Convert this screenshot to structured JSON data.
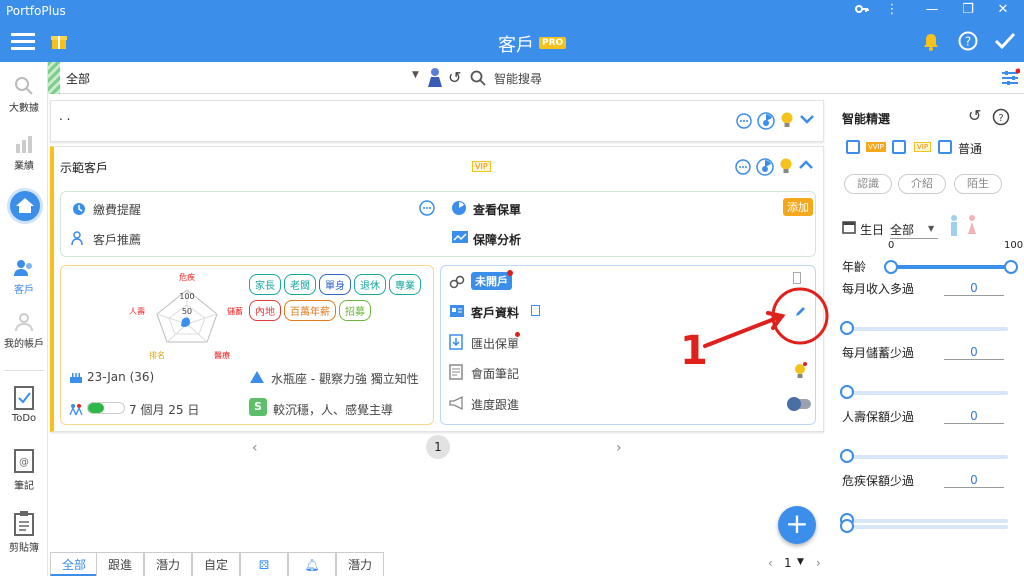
{
  "window": {
    "title": "PortfoPlus"
  },
  "appbar": {
    "title": "客戶",
    "badge": "PRO"
  },
  "nav": {
    "bigdata": "大數據",
    "performance": "業績",
    "clients": "客戶",
    "account": "我的帳戶",
    "todo": "ToDo",
    "notes": "筆記",
    "clipboard": "剪貼簿"
  },
  "filter": {
    "scope": "全部",
    "search_placeholder": "智能搜尋"
  },
  "client1": {
    "name": ". ."
  },
  "client2": {
    "name": "示範客戶",
    "vip": "VIP",
    "payment_reminder": "繳費提醒",
    "view_policy": "查看保單",
    "add_label": "添加",
    "referral": "客戶推薦",
    "coverage": "保障分析",
    "radar": {
      "top": "危疾",
      "left": "人壽",
      "right": "儲蓄",
      "bottom_left": "排名",
      "bottom_right": "醫療",
      "tick100": "100",
      "tick50": "50"
    },
    "tags": [
      {
        "label": "家長",
        "color": "#18a8a0"
      },
      {
        "label": "老闆",
        "color": "#18a8a0"
      },
      {
        "label": "單身",
        "color": "#2d66c8"
      },
      {
        "label": "退休",
        "color": "#18a8a0"
      },
      {
        "label": "專業",
        "color": "#18a8a0"
      },
      {
        "label": "內地",
        "color": "#e23a3a"
      },
      {
        "label": "百萬年薪",
        "color": "#e07a1b"
      },
      {
        "label": "招募",
        "color": "#6db53a"
      }
    ],
    "birthday": "23-Jan (36)",
    "zodiac": "水瓶座 - 觀察力強 獨立知性",
    "progress_text": "7 個月 25 日",
    "progress_pct": 0.45,
    "personality_badge": "S",
    "personality": "較沉穩，人、感覺主導",
    "status": "未開戶",
    "client_info": "客戶資料",
    "export_policy": "匯出保單",
    "meeting_notes": "會面筆記",
    "follow_up": "進度跟進"
  },
  "pagination": {
    "page": "1"
  },
  "annotation": {
    "number": "1"
  },
  "right_panel": {
    "title": "智能精選",
    "vvip": "VVIP",
    "vip": "VIP",
    "normal": "普通",
    "buttons": [
      "認識",
      "介紹",
      "陌生"
    ],
    "birthday_label": "生日",
    "birthday_value": "全部",
    "age_min": "0",
    "age_max": "100",
    "age_label": "年齡",
    "filters": [
      {
        "label": "每月收入多過",
        "value": "0"
      },
      {
        "label": "每月儲蓄少過",
        "value": "0"
      },
      {
        "label": "人壽保額少過",
        "value": "0"
      },
      {
        "label": "危疾保額少過",
        "value": "0"
      }
    ]
  },
  "bottom_tabs": [
    "全部",
    "跟進",
    "潛力",
    "自定",
    "",
    "",
    "潛力"
  ],
  "bottom_pager": {
    "page": "1"
  },
  "colors": {
    "primary": "#3b8eea",
    "accent": "#f4c21b",
    "annotation": "#e0201b"
  }
}
